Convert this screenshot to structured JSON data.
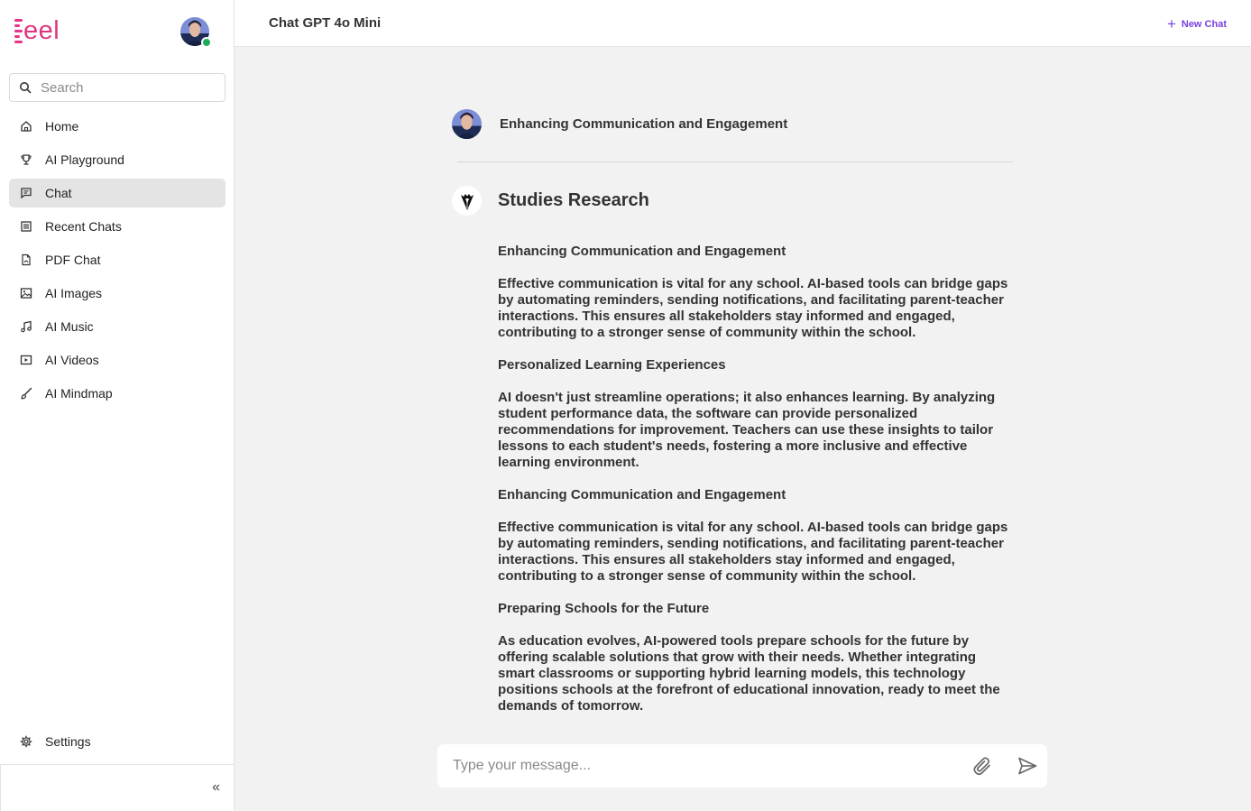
{
  "brand": {
    "logo_text": "eel"
  },
  "search": {
    "placeholder": "Search"
  },
  "nav": {
    "items": [
      {
        "label": "Home",
        "icon": "home-icon"
      },
      {
        "label": "AI Playground",
        "icon": "trophy-icon"
      },
      {
        "label": "Chat",
        "icon": "chat-icon",
        "active": true
      },
      {
        "label": "Recent Chats",
        "icon": "list-icon"
      },
      {
        "label": "PDF Chat",
        "icon": "pdf-icon"
      },
      {
        "label": "AI Images",
        "icon": "image-icon"
      },
      {
        "label": "AI Music",
        "icon": "music-icon"
      },
      {
        "label": "AI Videos",
        "icon": "video-icon"
      },
      {
        "label": "AI Mindmap",
        "icon": "brush-icon"
      }
    ],
    "settings_label": "Settings",
    "collapse_label": "«"
  },
  "header": {
    "model_title": "Chat GPT 4o Mini",
    "new_chat_label": "New Chat"
  },
  "conversation": {
    "user_message": "Enhancing Communication and Engagement",
    "bot_title": "Studies Research",
    "sections": [
      {
        "heading": "Enhancing Communication and Engagement",
        "body": "Effective communication is vital for any school. AI-based tools can bridge gaps by automating reminders, sending notifications, and facilitating parent-teacher interactions. This ensures all stakeholders stay informed and engaged, contributing to a stronger sense of community within the school."
      },
      {
        "heading": "Personalized Learning Experiences",
        "body": "AI doesn't just streamline operations; it also enhances learning. By analyzing student performance data, the software can provide personalized recommendations for improvement. Teachers can use these insights to tailor lessons to each student's needs, fostering a more inclusive and effective learning environment."
      },
      {
        "heading": "Enhancing Communication and Engagement",
        "body": "Effective communication is vital for any school. AI-based tools can bridge gaps by automating reminders, sending notifications, and facilitating parent-teacher interactions. This ensures all stakeholders stay informed and engaged, contributing to a stronger sense of community within the school."
      },
      {
        "heading": "Preparing Schools for the Future",
        "body": "As education evolves, AI-powered tools prepare schools for the future by offering scalable solutions that grow with their needs. Whether integrating smart classrooms or supporting hybrid learning models, this technology positions schools at the forefront of educational innovation, ready to meet the demands of tomorrow."
      }
    ]
  },
  "composer": {
    "placeholder": "Type your message..."
  },
  "colors": {
    "brand": "#e0367f",
    "accent": "#7a3fe0",
    "online": "#1fad5c",
    "active_nav": "#e4e4e4"
  }
}
